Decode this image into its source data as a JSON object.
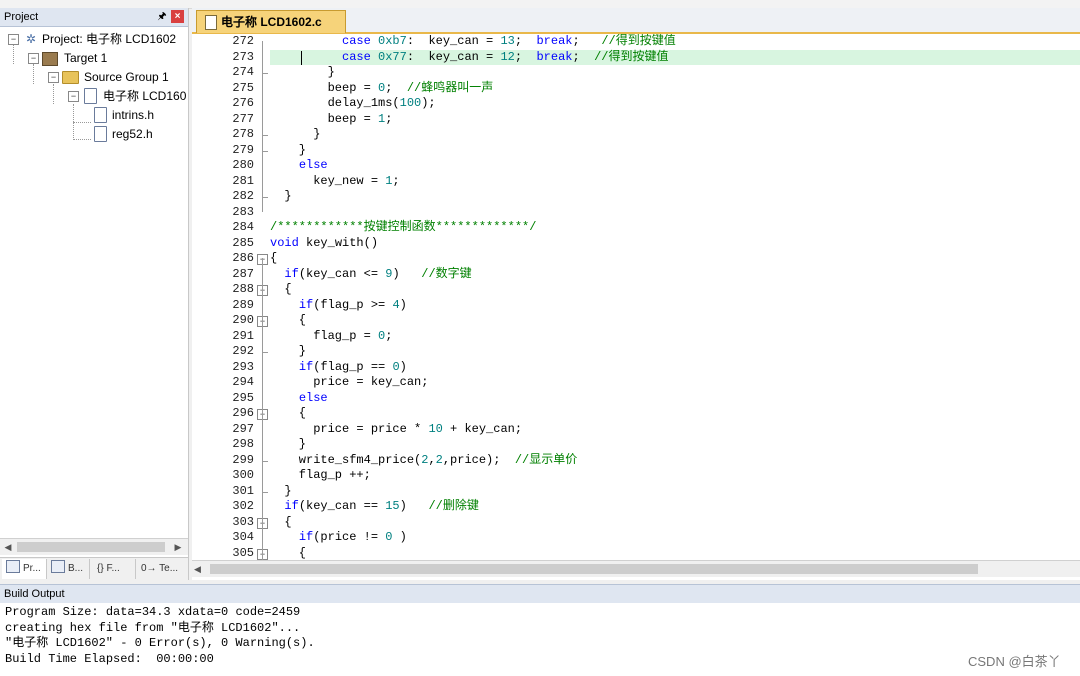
{
  "project_panel": {
    "title": "Project",
    "tree": [
      {
        "label": "Project: 电子称 LCD1602",
        "icon": "project-icon"
      },
      {
        "label": "Target 1",
        "icon": "target-icon"
      },
      {
        "label": "Source Group 1",
        "icon": "folder-icon"
      },
      {
        "label": "电子称 LCD160",
        "icon": "file-icon"
      },
      {
        "label": "intrins.h",
        "icon": "file-icon"
      },
      {
        "label": "reg52.h",
        "icon": "file-icon"
      }
    ],
    "tabs": [
      "Pr...",
      "B...",
      "{} F...",
      "0→ Te..."
    ]
  },
  "editor": {
    "tab_label": "电子称 LCD1602.c",
    "lines": [
      {
        "n": "272",
        "c": "case 0xb7:  key_can = 13;  break;   //得到按键值"
      },
      {
        "n": "273",
        "c": "case 0x77:  key_can = 12;  break;  //得到按键值"
      },
      {
        "n": "274",
        "c": "}"
      },
      {
        "n": "275",
        "c": "beep = 0;  //蜂鸣器叫一声"
      },
      {
        "n": "276",
        "c": "delay_1ms(100);"
      },
      {
        "n": "277",
        "c": "beep = 1;"
      },
      {
        "n": "278",
        "c": "}"
      },
      {
        "n": "279",
        "c": "}"
      },
      {
        "n": "280",
        "c": "else"
      },
      {
        "n": "281",
        "c": "key_new = 1;"
      },
      {
        "n": "282",
        "c": "}"
      },
      {
        "n": "283",
        "c": ""
      },
      {
        "n": "284",
        "c": "/************按键控制函数*************/"
      },
      {
        "n": "285",
        "c": "void key_with()"
      },
      {
        "n": "286",
        "c": "{"
      },
      {
        "n": "287",
        "c": "if(key_can <= 9)   //数字键"
      },
      {
        "n": "288",
        "c": "{"
      },
      {
        "n": "289",
        "c": "if(flag_p >= 4)"
      },
      {
        "n": "290",
        "c": "{"
      },
      {
        "n": "291",
        "c": "flag_p = 0;"
      },
      {
        "n": "292",
        "c": "}"
      },
      {
        "n": "293",
        "c": "if(flag_p == 0)"
      },
      {
        "n": "294",
        "c": "price = key_can;"
      },
      {
        "n": "295",
        "c": "else"
      },
      {
        "n": "296",
        "c": "{"
      },
      {
        "n": "297",
        "c": "price = price * 10 + key_can;"
      },
      {
        "n": "298",
        "c": "}"
      },
      {
        "n": "299",
        "c": "write_sfm4_price(2,2,price);  //显示单价"
      },
      {
        "n": "300",
        "c": "flag_p ++;"
      },
      {
        "n": "301",
        "c": "}"
      },
      {
        "n": "302",
        "c": "if(key_can == 15)   //删除键"
      },
      {
        "n": "303",
        "c": "{"
      },
      {
        "n": "304",
        "c": "if(price != 0 )"
      },
      {
        "n": "305",
        "c": "{"
      }
    ]
  },
  "build_output": {
    "title": "Build Output",
    "lines": [
      "Program Size: data=34.3 xdata=0 code=2459",
      "creating hex file from \"电子称 LCD1602\"...",
      "\"电子称 LCD1602\" - 0 Error(s), 0 Warning(s).",
      "Build Time Elapsed:  00:00:00"
    ]
  },
  "watermark": "CSDN @白茶丫",
  "colors": {
    "keyword": "#0000ff",
    "number": "#008080",
    "comment": "#008000",
    "highlight": "#d8f5e0",
    "tab_active": "#f6d37a"
  }
}
